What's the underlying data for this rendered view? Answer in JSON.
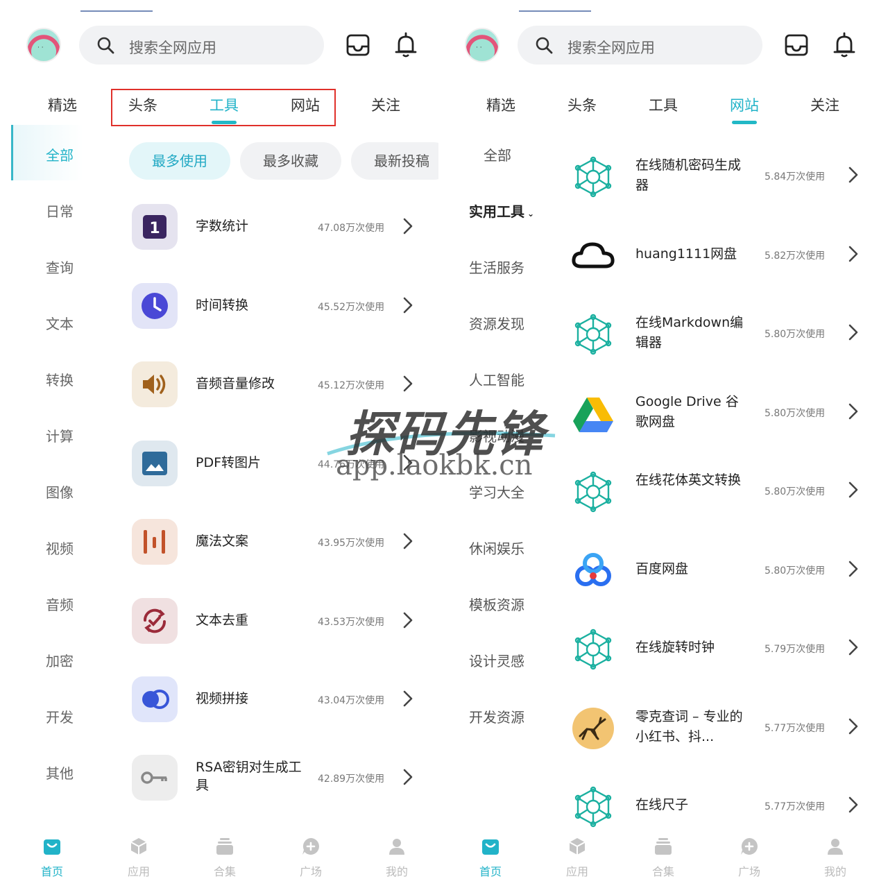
{
  "left": {
    "search_placeholder": "搜索全网应用",
    "tabs": [
      "精选",
      "头条",
      "工具",
      "网站",
      "关注"
    ],
    "active_tab": "工具",
    "sidebar": [
      "全部",
      "日常",
      "查询",
      "文本",
      "转换",
      "计算",
      "图像",
      "视频",
      "音频",
      "加密",
      "开发",
      "其他"
    ],
    "chips": [
      "最多使用",
      "最多收藏",
      "最新投稿"
    ],
    "apps": [
      {
        "name": "字数统计",
        "count": "47.08万次使用",
        "icon": "number-one-icon",
        "bg": "#e5e3ef",
        "fg": "#3a2560"
      },
      {
        "name": "时间转换",
        "count": "45.52万次使用",
        "icon": "clock-icon",
        "bg": "#e2e4f7",
        "fg": "#4a48d6"
      },
      {
        "name": "音频音量修改",
        "count": "45.12万次使用",
        "icon": "speaker-icon",
        "bg": "#f4ebdd",
        "fg": "#a0611c"
      },
      {
        "name": "PDF转图片",
        "count": "44.76万次使用",
        "icon": "image-icon",
        "bg": "#dfe8ef",
        "fg": "#2f6b9a"
      },
      {
        "name": "魔法文案",
        "count": "43.95万次使用",
        "icon": "bars-icon",
        "bg": "#f6e5dc",
        "fg": "#c2522a"
      },
      {
        "name": "文本去重",
        "count": "43.53万次使用",
        "icon": "sync-check-icon",
        "bg": "#f0e0e1",
        "fg": "#9b2b3a"
      },
      {
        "name": "视频拼接",
        "count": "43.04万次使用",
        "icon": "circles-icon",
        "bg": "#e0e5fa",
        "fg": "#3856d8"
      },
      {
        "name": "RSA密钥对生成工具",
        "count": "42.89万次使用",
        "icon": "key-icon",
        "bg": "#ededed",
        "fg": "#888888"
      }
    ]
  },
  "right": {
    "search_placeholder": "搜索全网应用",
    "tabs": [
      "精选",
      "头条",
      "工具",
      "网站",
      "关注"
    ],
    "active_tab": "网站",
    "categories": [
      "全部",
      "实用工具",
      "生活服务",
      "资源发现",
      "人工智能",
      "影视动漫",
      "学习大全",
      "休闲娱乐",
      "模板资源",
      "设计灵感",
      "开发资源"
    ],
    "sites": [
      {
        "name": "在线随机密码生成器",
        "count": "5.84万次使用",
        "logo": "network-hex-icon"
      },
      {
        "name": "huang1111网盘",
        "count": "5.82万次使用",
        "logo": "cloud-icon"
      },
      {
        "name": "在线Markdown编辑器",
        "count": "5.80万次使用",
        "logo": "network-hex-icon"
      },
      {
        "name": "Google Drive 谷歌网盘",
        "count": "5.80万次使用",
        "logo": "google-drive-icon"
      },
      {
        "name": "在线花体英文转换",
        "count": "5.80万次使用",
        "logo": "network-hex-icon"
      },
      {
        "name": "百度网盘",
        "count": "5.80万次使用",
        "logo": "baidu-netdisk-icon"
      },
      {
        "name": "在线旋转时钟",
        "count": "5.79万次使用",
        "logo": "network-hex-icon"
      },
      {
        "name": "零克查词 – 专业的小红书、抖...",
        "count": "5.77万次使用",
        "logo": "deer-icon"
      },
      {
        "name": "在线尺子",
        "count": "5.77万次使用",
        "logo": "network-hex-icon"
      }
    ]
  },
  "bottom_nav": [
    {
      "label": "首页",
      "icon": "home-bag-icon"
    },
    {
      "label": "应用",
      "icon": "cube-icon"
    },
    {
      "label": "合集",
      "icon": "stack-icon"
    },
    {
      "label": "广场",
      "icon": "chat-plus-icon"
    },
    {
      "label": "我的",
      "icon": "person-icon"
    }
  ],
  "watermark": {
    "title": "探码先锋",
    "url": "app.laokbk.cn"
  },
  "colors": {
    "accent": "#22b3c8",
    "highlight_border": "#e0302a"
  }
}
